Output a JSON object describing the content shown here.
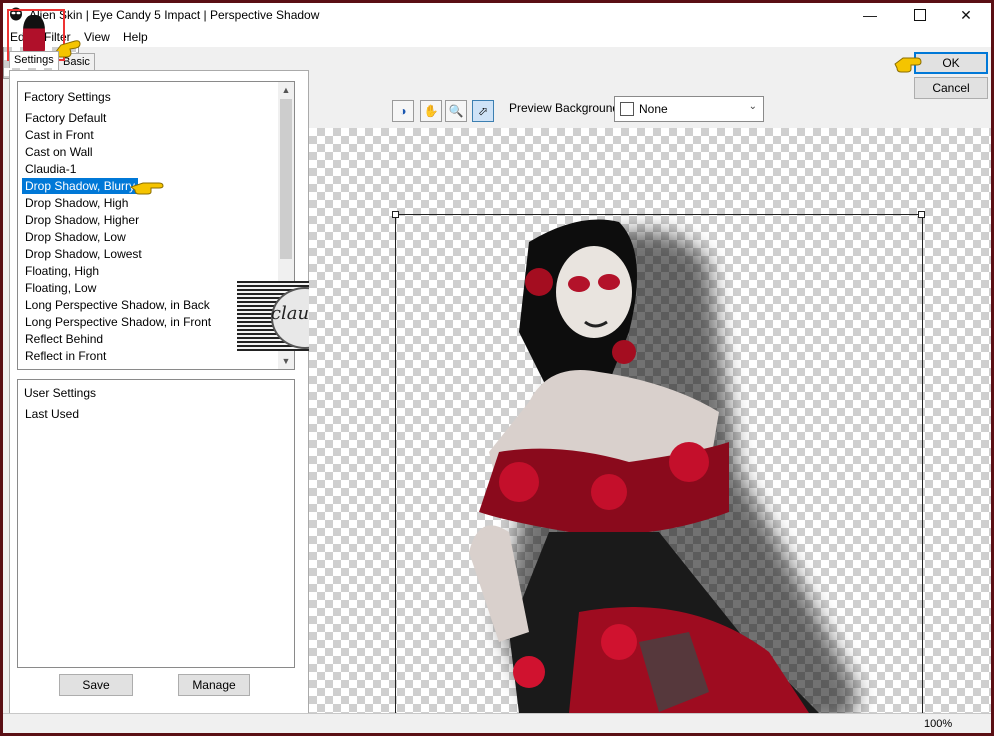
{
  "window": {
    "title": "Alien Skin | Eye Candy 5 Impact | Perspective Shadow",
    "controls": [
      "minimize",
      "maximize",
      "close"
    ]
  },
  "menu": [
    "Edit",
    "Filter",
    "View",
    "Help"
  ],
  "tabs": [
    {
      "label": "Settings",
      "active": true
    },
    {
      "label": "Basic",
      "active": false
    }
  ],
  "factory_list": {
    "header": "Factory Settings",
    "items": [
      "Factory Default",
      "Cast in Front",
      "Cast on Wall",
      "Claudia-1",
      "Drop Shadow, Blurry",
      "Drop Shadow, High",
      "Drop Shadow, Higher",
      "Drop Shadow, Low",
      "Drop Shadow, Lowest",
      "Floating, High",
      "Floating, Low",
      "Long Perspective Shadow, in Back",
      "Long Perspective Shadow, in Front",
      "Reflect Behind",
      "Reflect in Front"
    ],
    "selected": "Drop Shadow, Blurry"
  },
  "user_list": {
    "header": "User Settings",
    "items": [
      "Last Used"
    ]
  },
  "buttons": {
    "save": "Save",
    "manage": "Manage",
    "ok": "OK",
    "cancel": "Cancel"
  },
  "toolbar": {
    "preview_bg_label": "Preview Background:",
    "preview_bg_value": "None",
    "tools": [
      "preview-toggle",
      "hand",
      "zoom",
      "select"
    ]
  },
  "watermark": {
    "text": "claudia"
  },
  "status": {
    "zoom": "100%"
  },
  "colors": {
    "selection": "#0078d7",
    "frame": "#5a0f14",
    "pointer": "#f5c400"
  }
}
